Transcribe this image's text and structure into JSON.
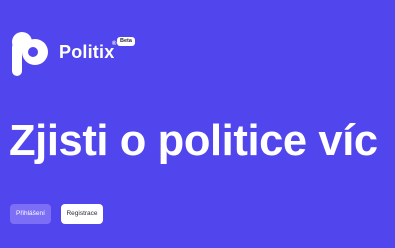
{
  "brand": {
    "name": "Politix",
    "registered_mark": "®",
    "badge": "Beta",
    "logo_icon": "politix-logo-icon"
  },
  "hero": {
    "title": "Zjisti o politice víc"
  },
  "actions": {
    "login_label": "Přihlášení",
    "register_label": "Registrace"
  },
  "colors": {
    "background": "#5145ed",
    "login_button_bg": "#7c6ff6",
    "register_button_bg": "#ffffff",
    "text": "#ffffff"
  }
}
